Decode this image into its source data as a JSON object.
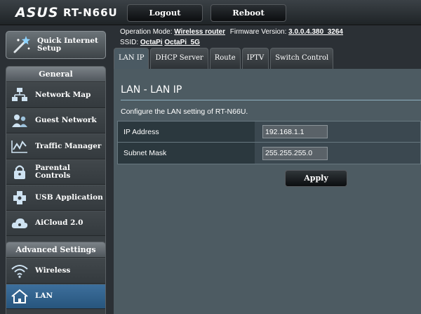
{
  "header": {
    "brand": "ASUS",
    "model": "RT-N66U",
    "logout_label": "Logout",
    "reboot_label": "Reboot"
  },
  "sidebar": {
    "quick_setup_label": "Quick Internet Setup",
    "general_title": "General",
    "general_items": [
      {
        "label": "Network Map",
        "icon": "network-map-icon"
      },
      {
        "label": "Guest Network",
        "icon": "guest-network-icon"
      },
      {
        "label": "Traffic Manager",
        "icon": "traffic-manager-icon"
      },
      {
        "label": "Parental Controls",
        "icon": "parental-controls-icon"
      },
      {
        "label": "USB Application",
        "icon": "usb-application-icon"
      },
      {
        "label": "AiCloud 2.0",
        "icon": "aicloud-icon"
      }
    ],
    "advanced_title": "Advanced Settings",
    "advanced_items": [
      {
        "label": "Wireless",
        "icon": "wireless-icon"
      },
      {
        "label": "LAN",
        "icon": "lan-icon",
        "active": true
      }
    ]
  },
  "info": {
    "op_mode_label": "Operation Mode:",
    "op_mode_value": "Wireless router",
    "firmware_label": "Firmware Version:",
    "firmware_value": "3.0.0.4.380_3264",
    "ssid_label": "SSID:",
    "ssid_1": "OctaPi",
    "ssid_2": "OctaPi_5G"
  },
  "tabs": [
    {
      "label": "LAN IP",
      "active": true
    },
    {
      "label": "DHCP Server"
    },
    {
      "label": "Route"
    },
    {
      "label": "IPTV"
    },
    {
      "label": "Switch Control"
    }
  ],
  "main": {
    "title": "LAN - LAN IP",
    "description": "Configure the LAN setting of RT-N66U.",
    "fields": [
      {
        "label": "IP Address",
        "value": "192.168.1.1"
      },
      {
        "label": "Subnet Mask",
        "value": "255.255.255.0"
      }
    ],
    "apply_label": "Apply"
  },
  "colors": {
    "panel_bg": "#4d5b62",
    "active_menu": "#3d6f9c",
    "field_header": "#2b383e"
  }
}
